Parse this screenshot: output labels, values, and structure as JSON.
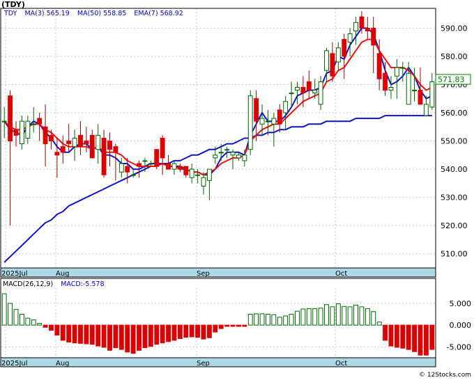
{
  "header": {
    "ticker_label": "(TDY)"
  },
  "legend": {
    "symbol": "TDY",
    "ma3": "MA(3)  565.19",
    "ma50": "MA(50)  558.85",
    "ema7": "EMA(7)  568.92"
  },
  "macd_legend": {
    "params": "MACD(26,12,9)",
    "value": "MACD:-5.578"
  },
  "watermark": "© 12Stocks.com",
  "colors": {
    "up": "#006400",
    "down": "#dd0000",
    "ma": "#1111cc",
    "ema": "#ee1111",
    "axis_band": "#add8e6",
    "price_tag": "#008000"
  },
  "chart_data": [
    {
      "type": "candlestick",
      "title": "(TDY)",
      "ylim": [
        505,
        597
      ],
      "y_ticks": [
        "510.00",
        "520.00",
        "530.00",
        "540.00",
        "550.00",
        "560.00",
        "570.00",
        "580.00",
        "590.00"
      ],
      "x_labels": [
        "2025Jul",
        "Aug",
        "Sep",
        "Oct"
      ],
      "last_price_label": "571.83",
      "ohlc": [
        [
          557,
          562,
          551,
          557
        ],
        [
          566,
          568,
          520,
          550
        ],
        [
          554,
          557,
          548,
          552
        ],
        [
          549,
          559,
          547,
          557
        ],
        [
          551,
          559,
          549,
          557
        ],
        [
          556,
          562,
          553,
          556
        ],
        [
          558,
          560,
          550,
          556
        ],
        [
          555,
          563,
          541,
          549
        ],
        [
          552,
          554,
          547,
          550
        ],
        [
          546,
          551,
          537,
          545
        ],
        [
          548,
          552,
          542,
          546
        ],
        [
          550,
          556,
          546,
          549
        ],
        [
          548,
          554,
          543,
          551
        ],
        [
          552,
          557,
          545,
          548
        ],
        [
          550,
          555,
          546,
          549
        ],
        [
          552,
          554,
          544,
          544
        ],
        [
          547,
          556,
          542,
          552
        ],
        [
          551,
          554,
          537,
          538
        ],
        [
          550,
          553,
          541,
          547
        ],
        [
          548,
          549,
          536,
          546
        ],
        [
          539,
          544,
          537,
          542
        ],
        [
          541,
          544,
          535,
          539
        ],
        [
          538,
          540,
          537,
          538
        ],
        [
          542,
          543,
          537,
          541
        ],
        [
          543,
          544,
          539,
          543
        ],
        [
          542,
          543,
          541,
          542
        ],
        [
          547,
          547,
          540,
          541
        ],
        [
          551,
          552,
          538,
          544
        ],
        [
          542,
          545,
          540,
          540
        ],
        [
          540,
          543,
          538,
          542
        ],
        [
          541,
          542,
          539,
          540
        ],
        [
          541,
          541,
          537,
          538
        ],
        [
          537,
          542,
          535,
          540
        ],
        [
          538,
          540,
          535,
          538
        ],
        [
          534,
          539,
          531,
          537
        ],
        [
          536,
          540,
          529,
          540
        ],
        [
          544,
          548,
          542,
          545
        ],
        [
          546,
          549,
          543,
          546
        ],
        [
          547,
          548,
          544,
          547
        ],
        [
          545,
          547,
          540,
          546
        ],
        [
          544,
          546,
          543,
          545
        ],
        [
          543,
          547,
          541,
          545
        ],
        [
          547,
          568,
          545,
          566
        ],
        [
          565,
          568,
          550,
          557
        ],
        [
          556,
          563,
          552,
          558
        ],
        [
          557,
          561,
          552,
          557
        ],
        [
          556,
          560,
          548,
          558
        ],
        [
          561,
          563,
          553,
          556
        ],
        [
          560,
          566,
          554,
          564
        ],
        [
          567,
          571,
          562,
          567
        ],
        [
          568,
          571,
          563,
          569
        ],
        [
          569,
          573,
          562,
          567
        ],
        [
          571,
          575,
          565,
          568
        ],
        [
          567,
          572,
          565,
          568
        ],
        [
          563,
          573,
          561,
          571
        ],
        [
          575,
          583,
          571,
          582
        ],
        [
          581,
          585,
          571,
          573
        ],
        [
          578,
          585,
          575,
          583
        ],
        [
          586,
          588,
          572,
          580
        ],
        [
          585,
          590,
          580,
          588
        ],
        [
          589,
          594,
          584,
          592
        ],
        [
          594,
          596,
          588,
          590
        ],
        [
          590,
          594,
          586,
          589
        ],
        [
          590,
          594,
          574,
          584
        ],
        [
          581,
          586,
          568,
          572
        ],
        [
          574,
          578,
          566,
          568
        ],
        [
          568,
          573,
          565,
          569
        ],
        [
          573,
          579,
          565,
          576
        ],
        [
          576,
          578,
          571,
          576
        ],
        [
          563,
          578,
          563,
          574
        ],
        [
          568,
          576,
          564,
          568
        ],
        [
          568,
          576,
          564,
          563
        ],
        [
          559,
          566,
          560,
          563
        ],
        [
          562,
          574,
          561,
          571
        ]
      ],
      "ma3": [
        557,
        554,
        553,
        552,
        555,
        557,
        556,
        553,
        551,
        548,
        546,
        546,
        548,
        549,
        549,
        547,
        548,
        545,
        545,
        544,
        542,
        542,
        540,
        540,
        541,
        542,
        542,
        542,
        541,
        541,
        541,
        540,
        539,
        539,
        538,
        538,
        540,
        544,
        546,
        546,
        546,
        545,
        552,
        556,
        560,
        557,
        557,
        557,
        559,
        562,
        566,
        567,
        568,
        568,
        569,
        574,
        575,
        580,
        579,
        584,
        587,
        590,
        590,
        588,
        582,
        575,
        570,
        571,
        573,
        576,
        573,
        568,
        565,
        566
      ],
      "ma50": [
        507,
        509,
        511,
        513,
        515,
        517,
        519,
        521,
        522,
        524,
        525,
        527,
        528,
        529,
        530,
        531,
        532,
        533,
        534,
        535,
        536,
        537,
        538,
        539,
        540,
        541,
        541,
        542,
        542,
        543,
        543,
        544,
        545,
        545,
        546,
        547,
        547,
        548,
        549,
        549,
        550,
        551,
        551,
        552,
        552,
        553,
        553,
        554,
        554,
        555,
        555,
        555,
        556,
        556,
        556,
        557,
        557,
        557,
        557,
        557,
        558,
        558,
        558,
        558,
        558,
        559,
        559,
        559,
        559,
        559,
        559,
        559,
        559,
        559
      ],
      "ema7": [
        557,
        555,
        554,
        554,
        555,
        556,
        556,
        554,
        553,
        551,
        549,
        548,
        548,
        548,
        548,
        547,
        548,
        546,
        546,
        546,
        545,
        543,
        542,
        541,
        541,
        541,
        541,
        542,
        541,
        541,
        540,
        540,
        539,
        539,
        538,
        539,
        540,
        542,
        543,
        544,
        544,
        545,
        550,
        552,
        554,
        555,
        556,
        556,
        558,
        560,
        562,
        564,
        565,
        566,
        567,
        571,
        572,
        575,
        576,
        579,
        582,
        585,
        586,
        586,
        582,
        579,
        576,
        576,
        576,
        575,
        573,
        570,
        568,
        569
      ]
    },
    {
      "type": "bar",
      "title": "MACD(26,12,9)",
      "ylim": [
        -7.5,
        8.5
      ],
      "y_ticks": [
        "5.000",
        "0.000",
        "-5.000"
      ],
      "x_labels": [
        "2025Jul",
        "Aug",
        "Sep",
        "Oct"
      ],
      "values": [
        7.2,
        5.0,
        3.6,
        2.5,
        1.6,
        1.2,
        0.4,
        -0.5,
        -1.2,
        -2.3,
        -3.5,
        -3.9,
        -4.1,
        -4.2,
        -4.3,
        -4.4,
        -4.8,
        -5.1,
        -5.8,
        -5.2,
        -5.6,
        -6.2,
        -6.5,
        -5.8,
        -5.2,
        -4.9,
        -4.4,
        -4.1,
        -3.8,
        -3.5,
        -3.1,
        -2.8,
        -2.7,
        -2.8,
        -3.2,
        -2.9,
        -1.6,
        -0.8,
        -0.3,
        -0.3,
        -0.3,
        -0.3,
        2.5,
        2.6,
        2.6,
        2.5,
        2.4,
        1.8,
        2.1,
        2.5,
        3.2,
        3.7,
        3.8,
        3.8,
        3.9,
        4.7,
        4.2,
        4.9,
        4.3,
        4.2,
        4.6,
        4.2,
        3.8,
        3.1,
        0.7,
        -3.5,
        -4.8,
        -5.1,
        -5.3,
        -5.6,
        -6.1,
        -6.9,
        -6.9,
        -5.6
      ]
    }
  ]
}
